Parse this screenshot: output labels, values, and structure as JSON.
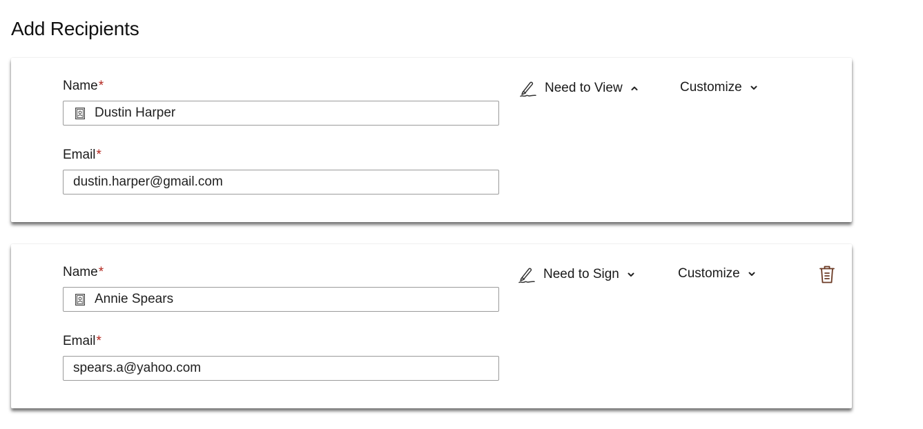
{
  "page": {
    "title": "Add Recipients"
  },
  "recipients": [
    {
      "name_label": "Name",
      "email_label": "Email",
      "required_mark": "*",
      "name": "Dustin Harper",
      "email": "dustin.harper@gmail.com",
      "role": "Need to View",
      "role_chevron": "chevron-up-icon",
      "customize": "Customize",
      "deletable": false
    },
    {
      "name_label": "Name",
      "email_label": "Email",
      "required_mark": "*",
      "name": "Annie Spears",
      "email": "spears.a@yahoo.com",
      "role": "Need to Sign",
      "role_chevron": "chevron-down-icon",
      "customize": "Customize",
      "deletable": true
    }
  ],
  "colors": {
    "required": "#b3261e",
    "trash_icon": "#6b3a24",
    "field_border": "#9a9a9a"
  }
}
